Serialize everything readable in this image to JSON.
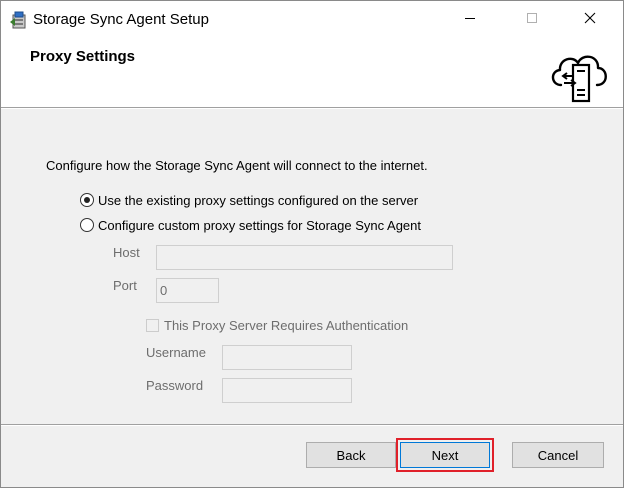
{
  "window": {
    "title": "Storage Sync Agent Setup",
    "controls": {
      "minimize_icon": "minimize-icon",
      "maximize_icon": "maximize-icon",
      "close_icon": "close-icon"
    }
  },
  "header": {
    "title": "Proxy Settings",
    "icon": "cloud-sync-icon"
  },
  "main": {
    "intro": "Configure how the Storage Sync Agent will connect to the internet.",
    "options": [
      {
        "label": "Use the existing proxy settings configured on the server",
        "selected": true
      },
      {
        "label": "Configure custom proxy settings for Storage Sync Agent",
        "selected": false
      }
    ],
    "host": {
      "label": "Host",
      "value": "",
      "enabled": false
    },
    "port": {
      "label": "Port",
      "value": "0",
      "enabled": false
    },
    "auth": {
      "label": "This Proxy Server Requires Authentication",
      "checked": false,
      "enabled": false
    },
    "username": {
      "label": "Username",
      "value": "",
      "enabled": false
    },
    "password": {
      "label": "Password",
      "value": "",
      "enabled": false
    }
  },
  "footer": {
    "back_label": "Back",
    "next_label": "Next",
    "cancel_label": "Cancel",
    "highlighted": "next"
  },
  "colors": {
    "highlight": "#e0202a",
    "focus_border": "#0078d7",
    "disabled_text": "#6d6d6d",
    "dialog_background": "#f0f0f0"
  }
}
